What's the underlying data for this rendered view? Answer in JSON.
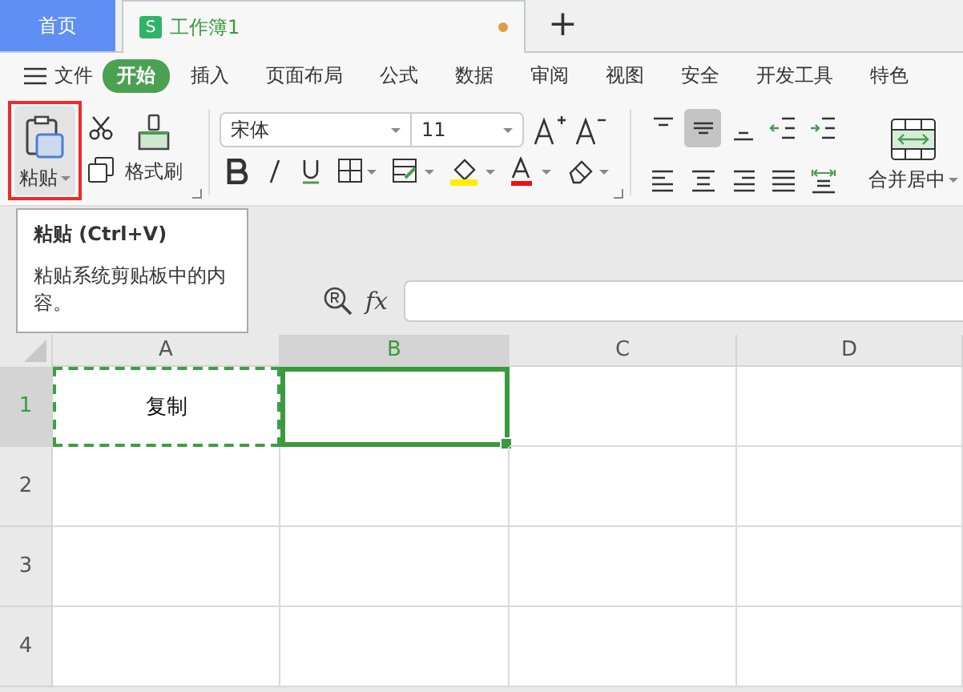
{
  "tabs": [
    {
      "label": "首页",
      "kind": "home",
      "selected": false
    },
    {
      "label": "工作簿1",
      "kind": "sheet",
      "icon_letter": "S",
      "unsaved": true,
      "selected": true
    }
  ],
  "new_tab_button": "+",
  "menu": {
    "file": "文件",
    "items": [
      {
        "label": "开始",
        "selected": true
      },
      {
        "label": "插入",
        "selected": false
      },
      {
        "label": "页面布局",
        "selected": false
      },
      {
        "label": "公式",
        "selected": false
      },
      {
        "label": "数据",
        "selected": false
      },
      {
        "label": "审阅",
        "selected": false
      },
      {
        "label": "视图",
        "selected": false
      },
      {
        "label": "安全",
        "selected": false
      },
      {
        "label": "开发工具",
        "selected": false
      },
      {
        "label": "特色",
        "selected": false
      }
    ]
  },
  "ribbon": {
    "paste": {
      "label": "粘贴",
      "highlighted": true
    },
    "format_painter": "格式刷",
    "font": "宋体",
    "font_size": "11",
    "merge": "合并居中",
    "align_buttons": [
      {
        "kind": "top",
        "selected": false
      },
      {
        "kind": "middle",
        "selected": true
      },
      {
        "kind": "bottom",
        "selected": false
      },
      {
        "kind": "outdent",
        "selected": false
      },
      {
        "kind": "indent",
        "selected": false
      },
      {
        "kind": "left",
        "selected": false
      },
      {
        "kind": "center",
        "selected": false
      },
      {
        "kind": "right",
        "selected": false
      },
      {
        "kind": "justify",
        "selected": false
      },
      {
        "kind": "distribute",
        "selected": false
      }
    ]
  },
  "tooltip": {
    "title": "粘贴 (Ctrl+V)",
    "text": "粘贴系统剪贴板中的内容。"
  },
  "formula_bar": {
    "fx": "fx"
  },
  "grid": {
    "columns": [
      {
        "label": "A",
        "selected": false
      },
      {
        "label": "B",
        "selected": true
      },
      {
        "label": "C",
        "selected": false
      },
      {
        "label": "D",
        "selected": false
      }
    ],
    "rows": [
      {
        "label": "1",
        "selected": true,
        "cells": [
          {
            "text": "复制",
            "copied": true,
            "selected": false
          },
          {
            "copied": false,
            "selected": true
          },
          {
            "copied": false,
            "selected": false
          },
          {
            "copied": false,
            "selected": false
          }
        ]
      },
      {
        "label": "2",
        "selected": false,
        "cells": [
          {
            "copied": false,
            "selected": false
          },
          {
            "copied": false,
            "selected": false
          },
          {
            "copied": false,
            "selected": false
          },
          {
            "copied": false,
            "selected": false
          }
        ]
      },
      {
        "label": "3",
        "selected": false,
        "cells": [
          {
            "copied": false,
            "selected": false
          },
          {
            "copied": false,
            "selected": false
          },
          {
            "copied": false,
            "selected": false
          },
          {
            "copied": false,
            "selected": false
          }
        ]
      },
      {
        "label": "4",
        "selected": false,
        "cells": [
          {
            "copied": false,
            "selected": false
          },
          {
            "copied": false,
            "selected": false
          },
          {
            "copied": false,
            "selected": false
          },
          {
            "copied": false,
            "selected": false
          }
        ]
      }
    ]
  }
}
